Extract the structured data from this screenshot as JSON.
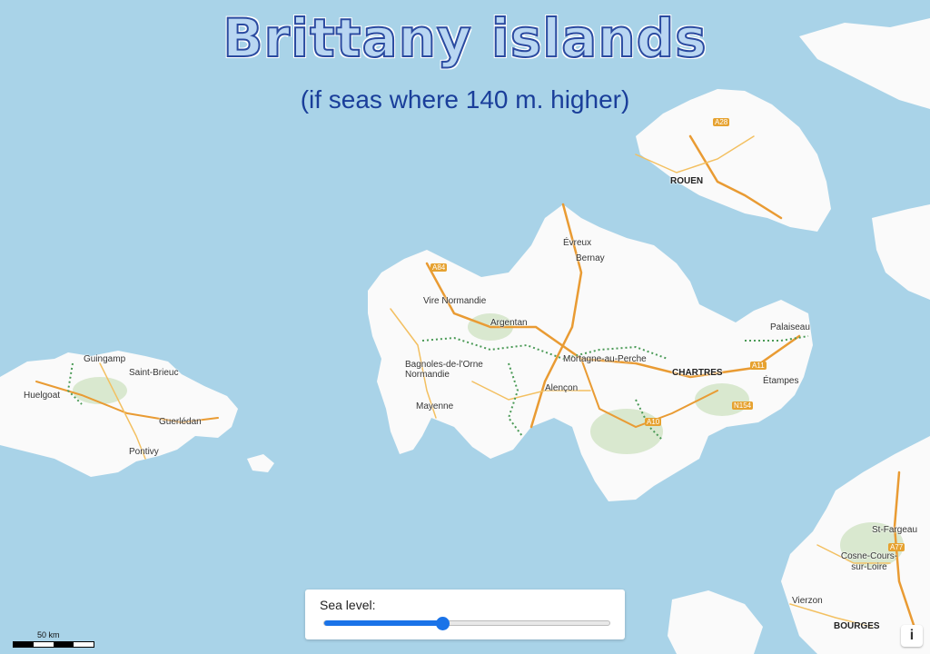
{
  "header": {
    "title": "Brittany islands",
    "subtitle": "(if seas where 140 m. higher)"
  },
  "map": {
    "colors": {
      "sea": "#a9d3e8",
      "land": "#fafafa",
      "forest": "#d9e8cf",
      "motorway": "#e99b33",
      "primary_road": "#f3c061",
      "trail": "#4a9a56"
    },
    "places": [
      {
        "id": "rouen",
        "label": "ROUEN"
      },
      {
        "id": "evreux",
        "label": "Évreux"
      },
      {
        "id": "bernay",
        "label": "Bernay"
      },
      {
        "id": "vire",
        "label": "Vire Normandie"
      },
      {
        "id": "argentan",
        "label": "Argentan"
      },
      {
        "id": "bagnoles",
        "label": "Bagnoles-de-l'Orne Normandie"
      },
      {
        "id": "mortagne",
        "label": "Mortagne-au-Perche"
      },
      {
        "id": "alencon",
        "label": "Alençon"
      },
      {
        "id": "mayenne",
        "label": "Mayenne"
      },
      {
        "id": "chartres",
        "label": "CHARTRES"
      },
      {
        "id": "etampes",
        "label": "Étampes"
      },
      {
        "id": "palaiseau",
        "label": "Palaiseau"
      },
      {
        "id": "guingamp",
        "label": "Guingamp"
      },
      {
        "id": "saint-brieuc",
        "label": "Saint-Brieuc"
      },
      {
        "id": "huelgoat",
        "label": "Huelgoat"
      },
      {
        "id": "guerledan",
        "label": "Guerlédan"
      },
      {
        "id": "pontivy",
        "label": "Pontivy"
      },
      {
        "id": "saint-fargeau",
        "label": "St-Fargeau"
      },
      {
        "id": "cosne",
        "label": "Cosne-Cours-sur-Loire"
      },
      {
        "id": "vierzon",
        "label": "Vierzon"
      },
      {
        "id": "bourges",
        "label": "BOURGES"
      }
    ],
    "roads": [
      {
        "id": "a84",
        "label": "A84"
      },
      {
        "id": "a28",
        "label": "A28"
      },
      {
        "id": "a11",
        "label": "A11"
      },
      {
        "id": "a10",
        "label": "A10"
      },
      {
        "id": "a77",
        "label": "A77"
      },
      {
        "id": "n154",
        "label": "N154"
      }
    ]
  },
  "controls": {
    "sea_level_label": "Sea level:",
    "sea_level_value": 140,
    "sea_level_fraction": 0.41,
    "info_icon": "info-icon",
    "info_label": "i"
  },
  "scale_bar": {
    "label": "50 km"
  }
}
